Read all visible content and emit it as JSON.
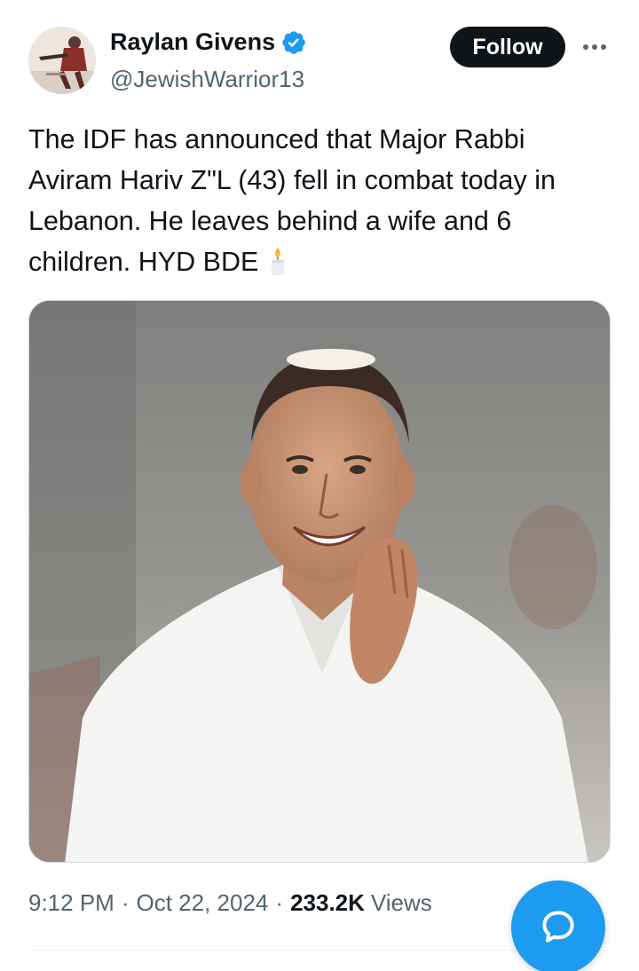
{
  "author": {
    "display_name": "Raylan Givens",
    "handle": "@JewishWarrior13",
    "verified": true
  },
  "actions": {
    "follow_label": "Follow",
    "more_icon": "more-horizontal-icon"
  },
  "tweet": {
    "text": "The IDF has announced that Major Rabbi Aviram Hariv Z\"L (43) fell in combat today in Lebanon. He leaves behind a wife and 6 children. HYD BDE",
    "emoji_icon": "candle-icon"
  },
  "meta": {
    "time": "9:12 PM",
    "separator": "·",
    "date": "Oct 22, 2024",
    "views_count": "233.2K",
    "views_label": "Views"
  },
  "fab": {
    "icon": "reply-bubble-icon"
  },
  "colors": {
    "accent": "#1d9bf0",
    "text": "#0f1419",
    "secondary": "#536471",
    "follow_bg": "#0f1419"
  }
}
